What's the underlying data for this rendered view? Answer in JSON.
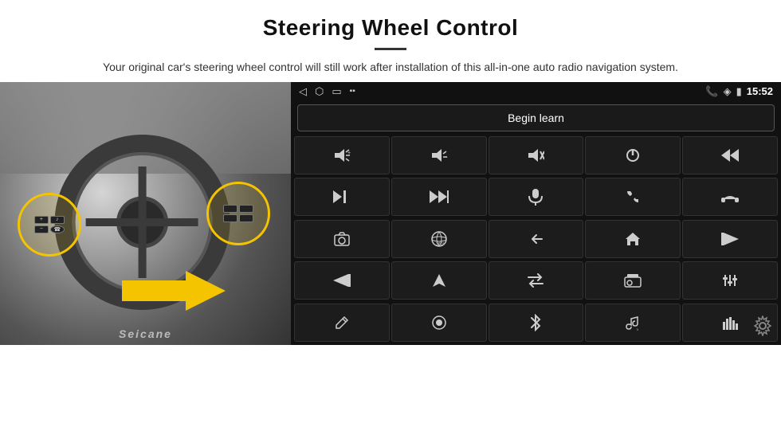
{
  "header": {
    "title": "Steering Wheel Control",
    "subtitle": "Your original car's steering wheel control will still work after installation of this all-in-one auto radio navigation system."
  },
  "status_bar": {
    "time": "15:52",
    "icons": [
      "back",
      "home",
      "recents",
      "signal"
    ]
  },
  "begin_learn_button": "Begin learn",
  "icons_grid": [
    {
      "symbol": "🔊+",
      "label": "vol-up"
    },
    {
      "symbol": "🔊−",
      "label": "vol-down"
    },
    {
      "symbol": "🔇",
      "label": "mute"
    },
    {
      "symbol": "⏻",
      "label": "power"
    },
    {
      "symbol": "⏮",
      "label": "prev-track"
    },
    {
      "symbol": "⏭",
      "label": "next"
    },
    {
      "symbol": "⏩",
      "label": "fast-fwd"
    },
    {
      "symbol": "🎤",
      "label": "mic"
    },
    {
      "symbol": "📞",
      "label": "call"
    },
    {
      "symbol": "↩",
      "label": "hang-up"
    },
    {
      "symbol": "📷",
      "label": "camera"
    },
    {
      "symbol": "👁360",
      "label": "360-view"
    },
    {
      "symbol": "↩",
      "label": "back"
    },
    {
      "symbol": "🏠",
      "label": "home"
    },
    {
      "symbol": "⏮|",
      "label": "prev"
    },
    {
      "symbol": "⏭|",
      "label": "skip"
    },
    {
      "symbol": "➤",
      "label": "nav"
    },
    {
      "symbol": "⇄",
      "label": "switch"
    },
    {
      "symbol": "📻",
      "label": "radio"
    },
    {
      "symbol": "⚙",
      "label": "settings"
    },
    {
      "symbol": "✏",
      "label": "edit"
    },
    {
      "symbol": "⏺",
      "label": "record"
    },
    {
      "symbol": "🔵",
      "label": "bluetooth"
    },
    {
      "symbol": "🎵",
      "label": "music"
    },
    {
      "symbol": "📊",
      "label": "equalizer"
    }
  ],
  "seicane_label": "Seicane",
  "gear_icon": "⚙"
}
